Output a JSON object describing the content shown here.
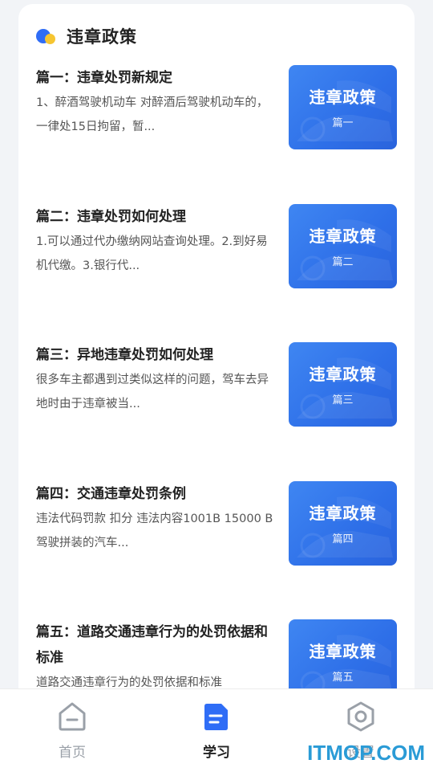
{
  "section": {
    "title": "违章政策"
  },
  "items": [
    {
      "title": "篇一：违章处罚新规定",
      "desc": "1、醉酒驾驶机动车 对醉酒后驾驶机动车的，一律处15日拘留，暂...",
      "thumb_title": "违章政策",
      "thumb_sub": "篇一"
    },
    {
      "title": "篇二：违章处罚如何处理",
      "desc": "1.可以通过代办缴纳网站查询处理。2.到好易机代缴。3.银行代...",
      "thumb_title": "违章政策",
      "thumb_sub": "篇二"
    },
    {
      "title": "篇三：异地违章处罚如何处理",
      "desc": "很多车主都遇到过类似这样的问题，驾车去异地时由于违章被当...",
      "thumb_title": "违章政策",
      "thumb_sub": "篇三"
    },
    {
      "title": "篇四：交通违章处罚条例",
      "desc": "违法代码罚款 扣分 违法内容1001B 15000 B 驾驶拼装的汽车...",
      "thumb_title": "违章政策",
      "thumb_sub": "篇四"
    },
    {
      "title": "篇五：道路交通违章行为的处罚依据和标准",
      "desc": "道路交通违章行为的处罚依据和标准",
      "thumb_title": "违章政策",
      "thumb_sub": "篇五"
    }
  ],
  "nav": {
    "home": "首页",
    "study": "学习",
    "settings": "设置"
  },
  "colors": {
    "accent": "#2f6df6",
    "inactive": "#9aa0a8",
    "active_text": "#222222"
  },
  "watermark": "ITMOP.COM"
}
